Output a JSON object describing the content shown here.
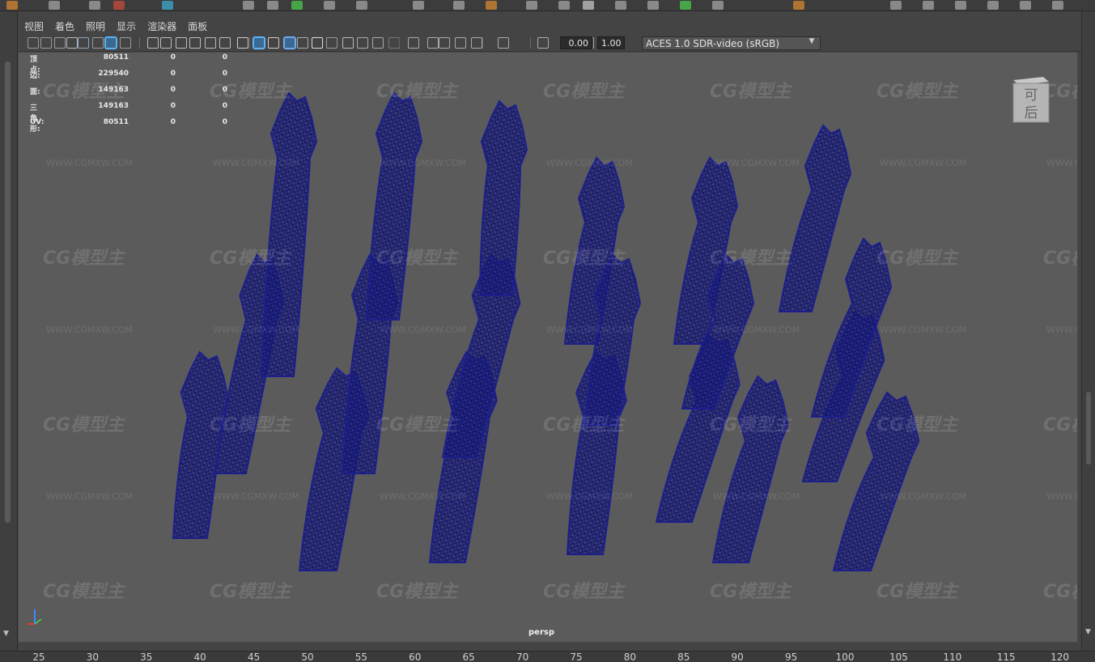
{
  "panel_menu": [
    "视图",
    "着色",
    "照明",
    "显示",
    "渲染器",
    "面板"
  ],
  "toolbar": {
    "exposure_value": "0.00",
    "gamma_value": "1.00",
    "color_space": "ACES 1.0 SDR-video (sRGB)",
    "icons": [
      "camera-select-icon",
      "camera-lock-icon",
      "camera-attributes-icon",
      "bookmark-icon",
      "image-plane-icon",
      "2d-pan-zoom-icon",
      "grease-pencil-icon",
      "grid-icon",
      "film-gate-icon",
      "resolution-gate-icon",
      "gate-mask-icon",
      "field-chart-icon",
      "safe-action-icon",
      "safe-title-icon",
      "wireframe-icon",
      "smooth-shade-icon",
      "use-default-material-icon",
      "wireframe-on-shaded-icon",
      "xray-icon",
      "use-all-lights-icon",
      "shadows-icon",
      "screen-space-ao-icon",
      "motion-blur-icon",
      "multisample-aa-icon",
      "depth-of-field-icon",
      "isolate-select-icon",
      "xray-joints-icon",
      "xray-active-icon",
      "frame-selection-icon",
      "frame-all-icon",
      "exposure-icon",
      "gamma-icon",
      "color-management-icon"
    ]
  },
  "hud": {
    "rows": [
      {
        "label": "顶点:",
        "v1": "80511",
        "v2": "0",
        "v3": "0"
      },
      {
        "label": "边:",
        "v1": "229540",
        "v2": "0",
        "v3": "0"
      },
      {
        "label": "面:",
        "v1": "149163",
        "v2": "0",
        "v3": "0"
      },
      {
        "label": "三角形:",
        "v1": "149163",
        "v2": "0",
        "v3": "0"
      },
      {
        "label": "UV:",
        "v1": "80511",
        "v2": "0",
        "v3": "0"
      }
    ]
  },
  "viewcube": {
    "top_label": "可",
    "front_label": "后"
  },
  "camera_label": "persp",
  "watermark": {
    "logo": "CG模型主",
    "url": "WWW.CGMXW.COM"
  },
  "ruler": {
    "labels": [
      "25",
      "30",
      "35",
      "40",
      "45",
      "50",
      "55",
      "60",
      "65",
      "70",
      "75",
      "80",
      "85",
      "90",
      "95",
      "100",
      "105",
      "110",
      "115",
      "120"
    ]
  },
  "colors": {
    "wire": "#1c1f8a",
    "viewport_bg": "#5b5b5b",
    "accent": "#3a6a94"
  }
}
